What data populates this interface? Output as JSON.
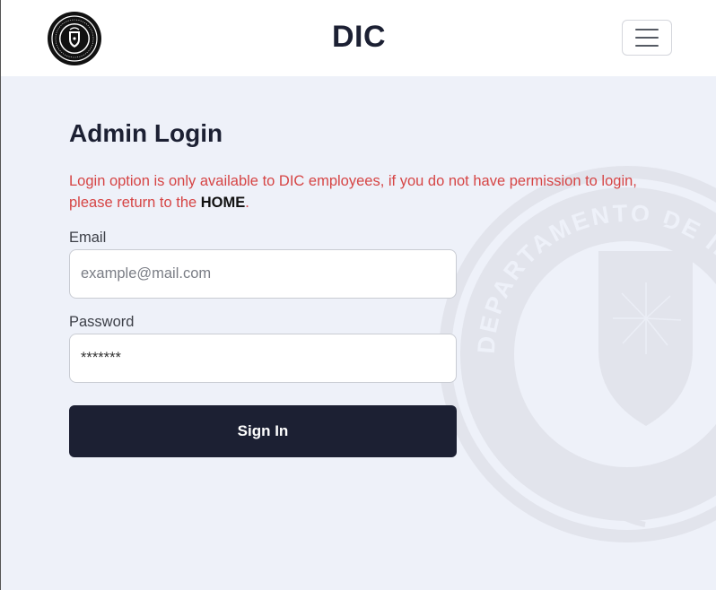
{
  "header": {
    "brand": "DIC",
    "logo_icon": "dic-seal-icon",
    "menu_icon": "hamburger-menu-icon"
  },
  "main": {
    "title": "Admin Login",
    "notice_text": "Login option is only available to DIC employees, if you do not have permission to login, please return to the ",
    "notice_link": "HOME",
    "notice_end": "."
  },
  "form": {
    "email_label": "Email",
    "email_placeholder": "example@mail.com",
    "email_value": "",
    "password_label": "Password",
    "password_value": "*******",
    "submit_label": "Sign In"
  },
  "watermark": {
    "text": "DEPARTAMENTO DE INVESTIGACIONES CRIMINALES",
    "icon": "eagle-shield-seal-icon"
  },
  "colors": {
    "navy": "#1c2033",
    "notice_red": "#d64545",
    "page_bg": "#eef1f9"
  }
}
